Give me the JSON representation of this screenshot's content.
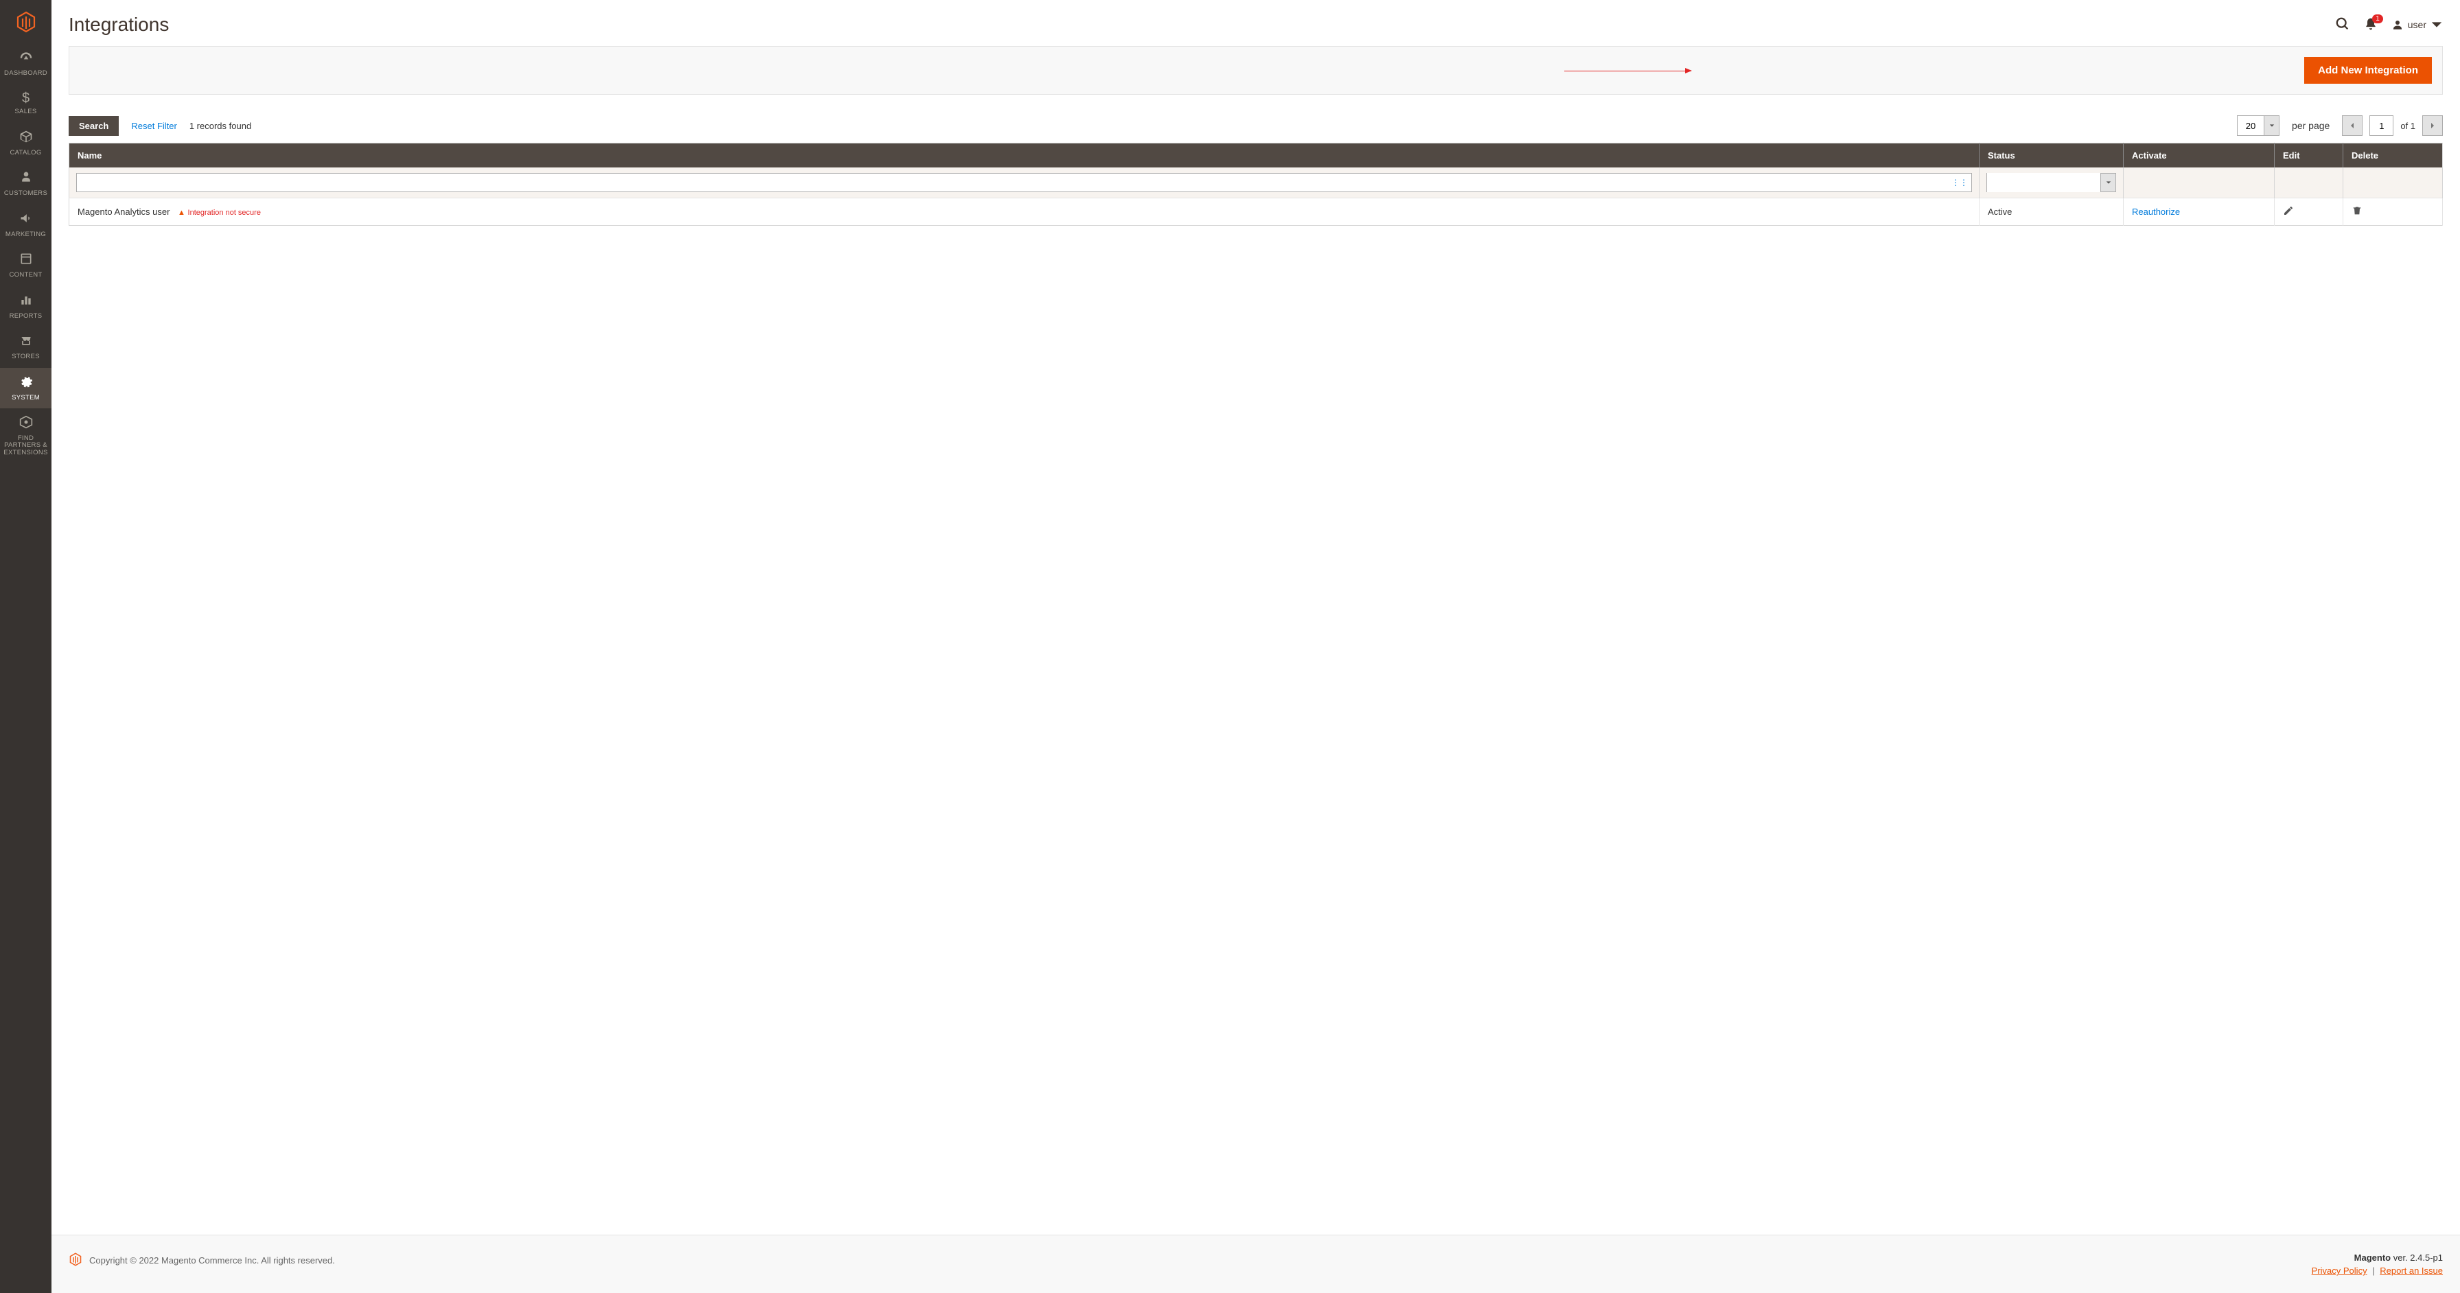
{
  "page_title": "Integrations",
  "header": {
    "notification_count": "1",
    "username": "user"
  },
  "sidebar": {
    "items": [
      {
        "label": "DASHBOARD"
      },
      {
        "label": "SALES"
      },
      {
        "label": "CATALOG"
      },
      {
        "label": "CUSTOMERS"
      },
      {
        "label": "MARKETING"
      },
      {
        "label": "CONTENT"
      },
      {
        "label": "REPORTS"
      },
      {
        "label": "STORES"
      },
      {
        "label": "SYSTEM"
      },
      {
        "label": "FIND PARTNERS & EXTENSIONS"
      }
    ]
  },
  "actions": {
    "add_integration": "Add New Integration"
  },
  "grid": {
    "search_label": "Search",
    "reset_label": "Reset Filter",
    "records_text": "1 records found",
    "per_page_value": "20",
    "per_page_label": "per page",
    "page_current": "1",
    "page_of_label": "of 1",
    "columns": {
      "name": "Name",
      "status": "Status",
      "activate": "Activate",
      "edit": "Edit",
      "delete": "Delete"
    },
    "rows": [
      {
        "name": "Magento Analytics user",
        "warn": "Integration not secure",
        "status": "Active",
        "activate": "Reauthorize"
      }
    ]
  },
  "footer": {
    "copyright": "Copyright © 2022 Magento Commerce Inc. All rights reserved.",
    "product": "Magento",
    "version": " ver. 2.4.5-p1",
    "privacy": "Privacy Policy",
    "report": "Report an Issue"
  }
}
